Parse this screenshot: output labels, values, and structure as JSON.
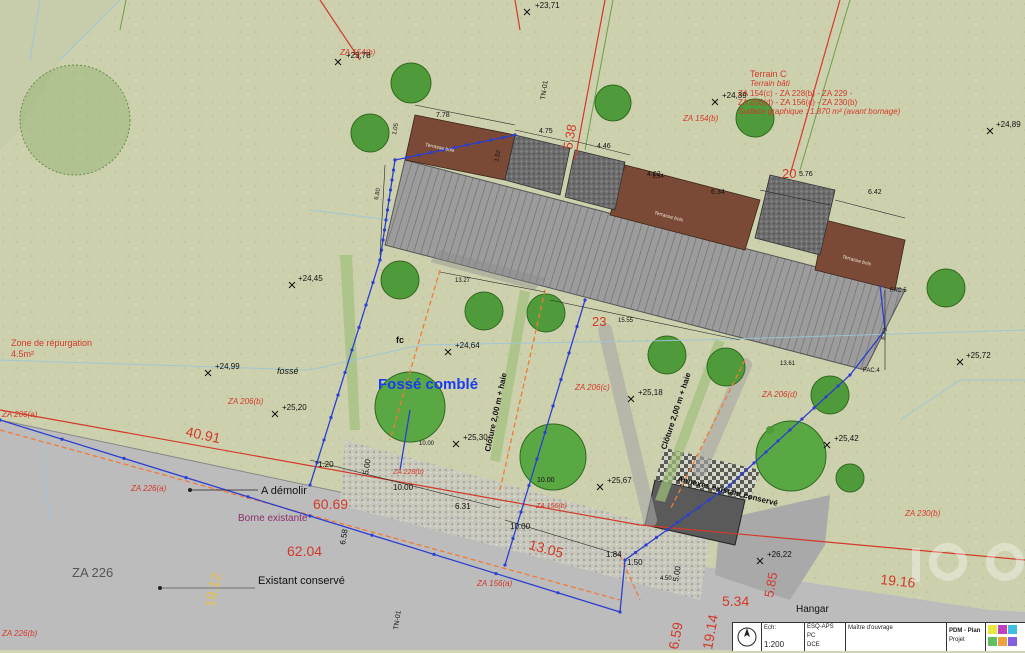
{
  "plan": {
    "zones": {
      "zone_repurgation": "Zone de répurgation",
      "zone_repurgation_area": "4.5m²",
      "fosse": "fossé",
      "fosse_comble": "Fossé comblé",
      "fc": "fc"
    },
    "terrain": {
      "title": "Terrain C",
      "subtitle": "Terrain bâti",
      "line1": "ZA 154(c) - ZA 228(b) - ZA 229 -",
      "line2": "ZA 206(d) - ZA 156(c) - ZA 230(b)",
      "line3": "Surface graphique : 1.870 m² (avant bornage)"
    },
    "parcels": [
      "ZA 154(b)",
      "ZA 154(b)",
      "ZA 206(b)",
      "ZA 206(c)",
      "ZA 206(d)",
      "ZA 230(b)",
      "ZA 226(a)",
      "ZA 206(a)",
      "ZA 226(b)",
      "ZA 156(a)",
      "ZA 226",
      "ZA 228(b)",
      "ZA 156(b)"
    ],
    "spot_levels": [
      "+23,71",
      "+23,78",
      "+24,39",
      "+24,89",
      "+24,45",
      "+24,99",
      "+25,20",
      "+24,64",
      "+25,18",
      "+25,72",
      "+25,42",
      "+25,30",
      "+25,67",
      "+26,22"
    ],
    "big_dims": [
      "40.91",
      "60.69",
      "62.04",
      "19.12",
      "13.05",
      "5.85",
      "5.34",
      "19.16",
      "19.14",
      "6.59",
      "5.38",
      "23",
      "20"
    ],
    "small_dims": [
      "7.78",
      "4.75",
      "4.46",
      "4.62",
      "6.34",
      "5.76",
      "6.42",
      "1.52",
      "1.05",
      "6.80",
      "3.54",
      "13.27",
      "15.55",
      "13.61",
      "6.73",
      "10.00",
      "10.00",
      "10.00",
      "6.31",
      "1.20",
      "5.00",
      "6.58",
      "1.84",
      "1.50",
      "5.00",
      "10.00",
      "4.50"
    ],
    "labels": {
      "a_demolir": "A démolir",
      "borne_existante": "Borne existante",
      "existant_conserve": "Existant conservé",
      "annexes": "Annexes existant conservé",
      "cloture_1": "Clôture 2,00 m + haie",
      "cloture_2": "Clôture 2,00 m + haie",
      "hangar": "Hangar",
      "fac5": "FAC.5",
      "fac4": "FAC.4",
      "tn01_top": "TN-01",
      "tn01_bottom": "TN-01",
      "terrasse": "Terrasse bois"
    },
    "title_block": {
      "scale_label": "Ech:",
      "scale": "1:200",
      "phase1": "ESQ-APS",
      "phase2": "PC",
      "phase3": "DCE",
      "client_label": "Maître d'ouvrage",
      "sheet": "PDM - Plan",
      "sub": "Projet"
    },
    "colors": {
      "red": "#d23a2a",
      "blue": "#2c3fd0",
      "orange": "#f07a3a",
      "roof_grey": "#9a9a9a",
      "roof_wood": "#7a4a36",
      "tree": "#4f9a3a",
      "road": "#b9b9b9",
      "grass": "#cdd0ad"
    }
  }
}
